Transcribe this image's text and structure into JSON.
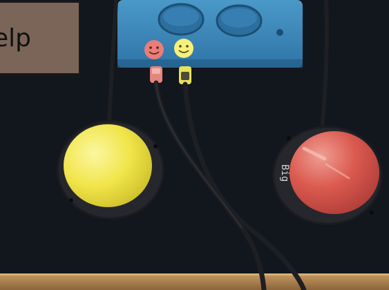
{
  "overlay": {
    "help_text": "elp"
  },
  "switch_label": {
    "text": "Big"
  },
  "colors": {
    "background": "#0d0f14",
    "switch_interface": "#3a86b6",
    "yellow_button": "#f0e64a",
    "red_button": "#d9504a",
    "board_edge": "#a0784a",
    "overlay_box": "#7a6558"
  },
  "objects": {
    "items": [
      "switch-interface-box",
      "yellow-switch",
      "red-switch",
      "cables",
      "wooden-board-edge"
    ]
  }
}
